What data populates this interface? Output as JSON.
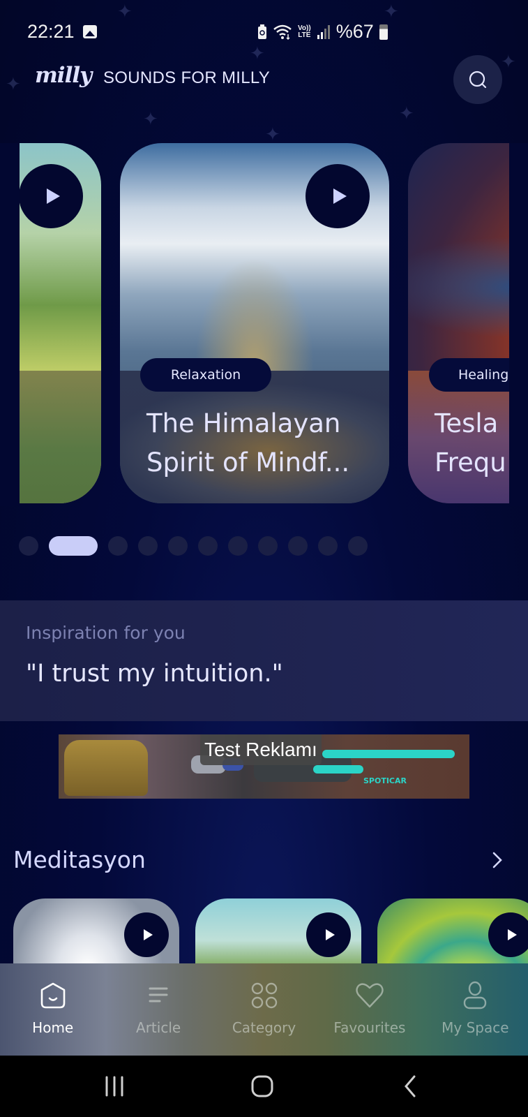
{
  "status_bar": {
    "time": "22:21",
    "gallery_icon": "image-icon",
    "battery_saver_icon": "battery-recycle-icon",
    "wifi_icon": "wifi-icon",
    "volte_top": "Vo))",
    "volte_bottom": "LTE",
    "signal_icon": "signal-bars-icon",
    "battery_percent": "%67",
    "battery_icon": "battery-icon"
  },
  "header": {
    "logo": "milly",
    "title": "SOUNDS FOR MILLY",
    "search_icon": "search-icon"
  },
  "carousel": {
    "cards": [
      {
        "category": "",
        "title": "",
        "partial": "left"
      },
      {
        "category": "Relaxation",
        "title": "The Himalayan\nSpirit of Mindf..."
      },
      {
        "category": "Healing",
        "title": "Tesla\nFrequ",
        "partial": "right"
      }
    ],
    "dot_count": 11,
    "active_index": 1
  },
  "inspiration": {
    "label": "Inspiration for you",
    "quote": "\"I trust my intuition.\""
  },
  "ad": {
    "label": "Test Reklamı",
    "brand": "SPOTICAR"
  },
  "section": {
    "title": "Meditasyon",
    "more_icon": "chevron-right-icon"
  },
  "bottom_nav": {
    "items": [
      {
        "label": "Home",
        "icon": "home-icon",
        "active": true
      },
      {
        "label": "Article",
        "icon": "article-icon",
        "active": false
      },
      {
        "label": "Category",
        "icon": "category-grid-icon",
        "active": false
      },
      {
        "label": "Favourites",
        "icon": "heart-icon",
        "active": false
      },
      {
        "label": "My Space",
        "icon": "user-icon",
        "active": false
      }
    ]
  },
  "system_nav": {
    "recents": "recents-icon",
    "home": "home-button-icon",
    "back": "back-icon"
  },
  "colors": {
    "background": "#020731",
    "accent": "#c9cdf8",
    "play_button": "#03072f",
    "card_text": "#e4e4ff"
  }
}
